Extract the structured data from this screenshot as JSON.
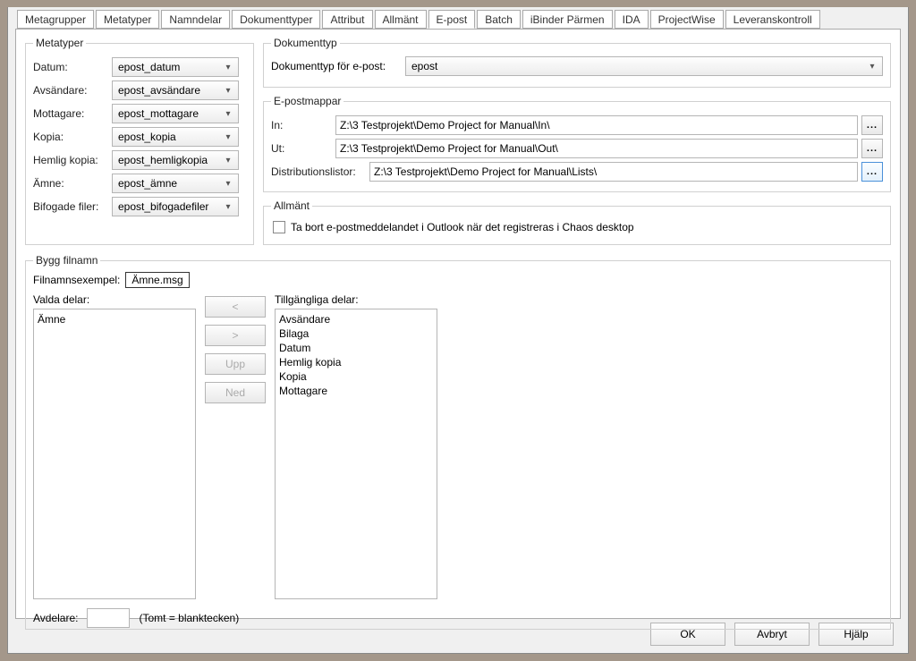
{
  "tabs": [
    "Metagrupper",
    "Metatyper",
    "Namndelar",
    "Dokumenttyper",
    "Attribut",
    "Allmänt",
    "E-post",
    "Batch",
    "iBinder Pärmen",
    "IDA",
    "ProjectWise",
    "Leveranskontroll"
  ],
  "active_tab_index": 6,
  "metatyper": {
    "legend": "Metatyper",
    "rows": [
      {
        "label": "Datum:",
        "value": "epost_datum"
      },
      {
        "label": "Avsändare:",
        "value": "epost_avsändare"
      },
      {
        "label": "Mottagare:",
        "value": "epost_mottagare"
      },
      {
        "label": "Kopia:",
        "value": "epost_kopia"
      },
      {
        "label": "Hemlig kopia:",
        "value": "epost_hemligkopia"
      },
      {
        "label": "Ämne:",
        "value": "epost_ämne"
      },
      {
        "label": "Bifogade filer:",
        "value": "epost_bifogadefiler"
      }
    ]
  },
  "dokumenttyp": {
    "legend": "Dokumenttyp",
    "label": "Dokumenttyp för e-post:",
    "value": "epost"
  },
  "folders": {
    "legend": "E-postmappar",
    "rows": [
      {
        "label": "In:",
        "value": "Z:\\3 Testprojekt\\Demo Project for Manual\\In\\"
      },
      {
        "label": "Ut:",
        "value": "Z:\\3 Testprojekt\\Demo Project for Manual\\Out\\"
      },
      {
        "label": "Distributionslistor:",
        "value": "Z:\\3 Testprojekt\\Demo Project for Manual\\Lists\\"
      }
    ],
    "browse_label": "..."
  },
  "allmant": {
    "legend": "Allmänt",
    "checkbox_label": "Ta bort e-postmeddelandet i Outlook när det registreras i Chaos desktop"
  },
  "build": {
    "legend": "Bygg filnamn",
    "example_label": "Filnamnsexempel:",
    "example_value": "Ämne.msg",
    "valda_label": "Valda delar:",
    "tillgangliga_label": "Tillgängliga delar:",
    "valda": [
      "Ämne"
    ],
    "tillgangliga": [
      "Avsändare",
      "Bilaga",
      "Datum",
      "Hemlig kopia",
      "Kopia",
      "Mottagare"
    ],
    "buttons": {
      "left": "<",
      "right": ">",
      "upp": "Upp",
      "ned": "Ned"
    },
    "avdelare_label": "Avdelare:",
    "avdelare_value": "",
    "avdelare_hint": "(Tomt = blanktecken)"
  },
  "dialog_buttons": {
    "ok": "OK",
    "cancel": "Avbryt",
    "help": "Hjälp"
  }
}
